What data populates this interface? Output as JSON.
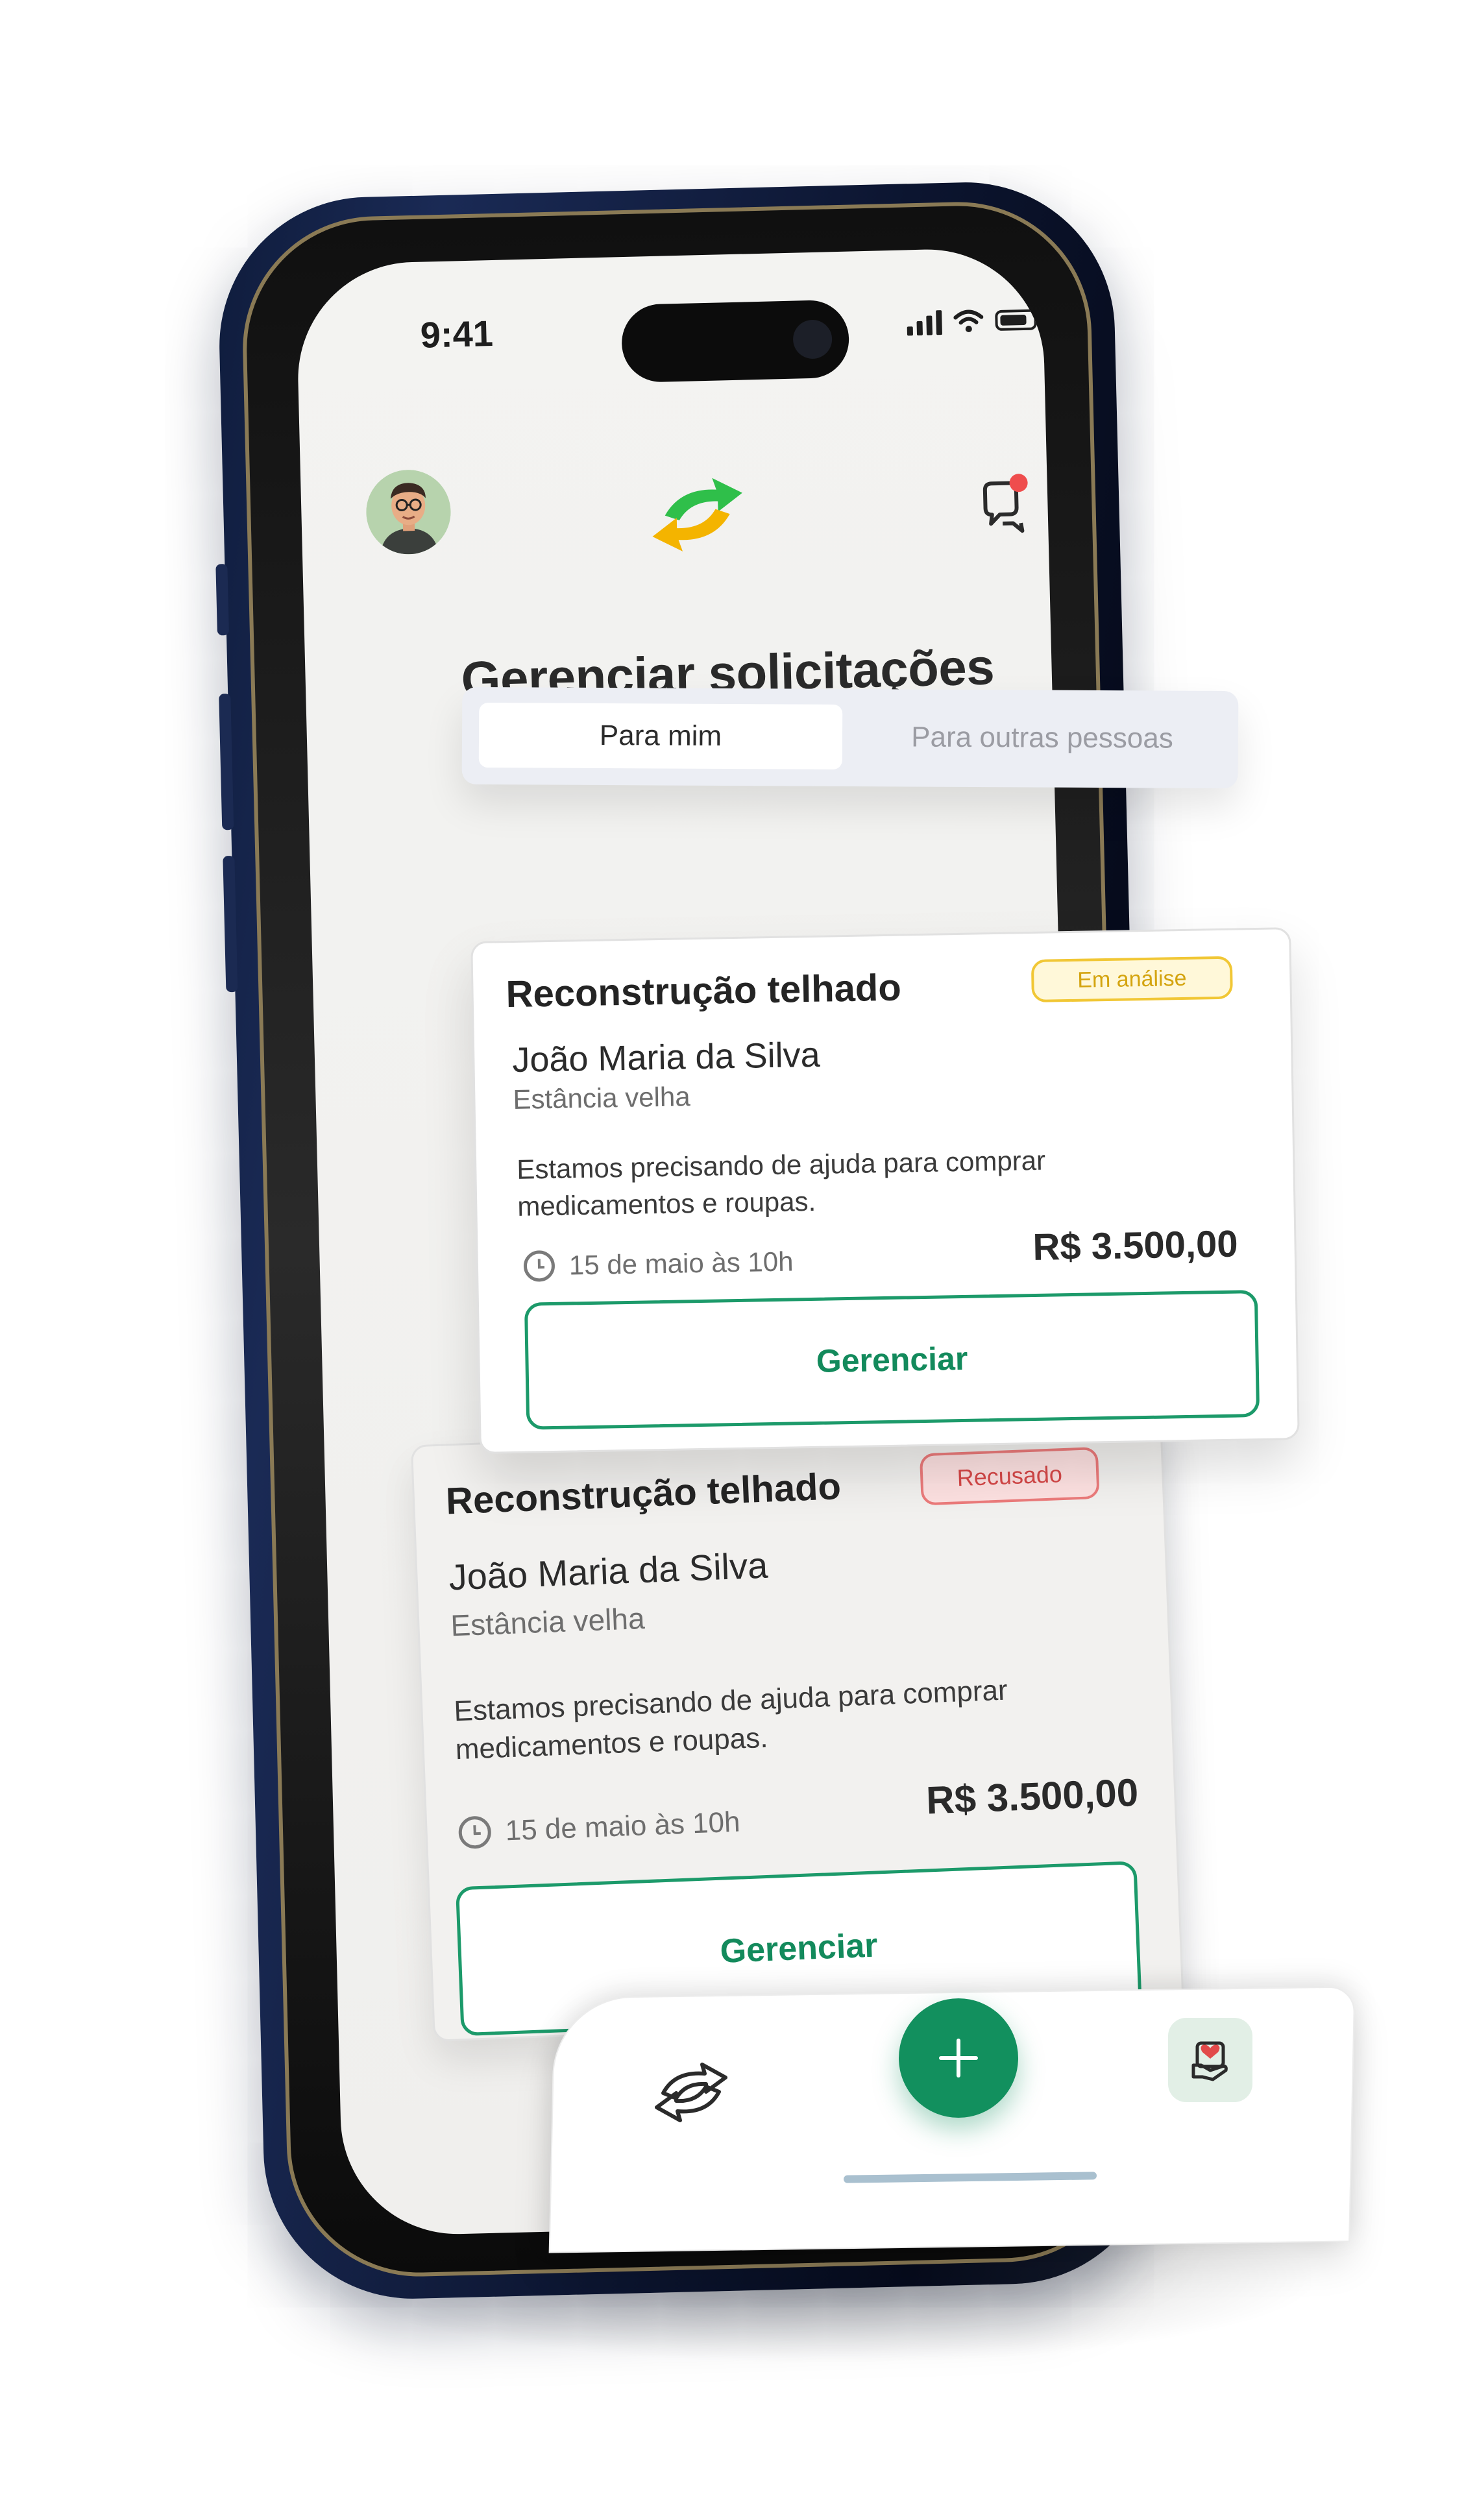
{
  "status_bar": {
    "time": "9:41"
  },
  "header": {
    "avatar": "user-avatar",
    "logo": "swap-arrows-logo",
    "notifications_icon": "chat-bell-icon"
  },
  "page": {
    "title": "Gerenciar solicitações"
  },
  "tabs": [
    {
      "label": "Para mim",
      "active": true
    },
    {
      "label": "Para outras pessoas",
      "active": false
    }
  ],
  "requests": [
    {
      "title": "Reconstrução telhado",
      "status": "Em análise",
      "status_color": "#f1c735",
      "name": "João Maria da Silva",
      "location": "Estância velha",
      "description_line1": "Estamos precisando de ajuda para comprar",
      "description_line2": "medicamentos e roupas.",
      "date": "15 de maio às 10h",
      "amount": "R$ 3.500,00",
      "action": "Gerenciar"
    },
    {
      "title": "Reconstrução telhado",
      "status": "Recusado",
      "status_color": "#ec7b7b",
      "name": "João Maria da Silva",
      "location": "Estância velha",
      "description_line1": "Estamos precisando de ajuda para comprar",
      "description_line2": "medicamentos e roupas.",
      "date": "15 de maio às 10h",
      "amount": "R$ 3.500,00",
      "action": "Gerenciar"
    }
  ],
  "bottom_nav": {
    "home_icon": "swap-arrows-outline-icon",
    "add_icon": "plus-icon",
    "help_icon": "hand-heart-icon"
  },
  "colors": {
    "primary": "#12905e",
    "accent_yellow": "#f4b400",
    "accent_green": "#2fbf4a"
  }
}
